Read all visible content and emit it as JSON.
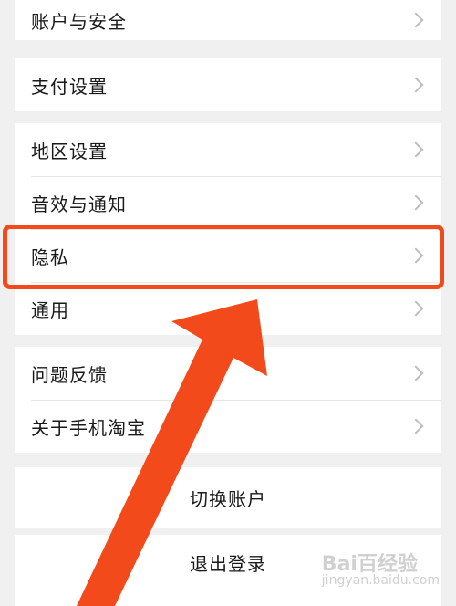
{
  "groups": [
    {
      "items": [
        {
          "label": "账户与安全"
        }
      ]
    },
    {
      "items": [
        {
          "label": "支付设置"
        }
      ]
    },
    {
      "items": [
        {
          "label": "地区设置"
        },
        {
          "label": "音效与通知"
        },
        {
          "label": "隐私"
        },
        {
          "label": "通用"
        }
      ]
    },
    {
      "items": [
        {
          "label": "问题反馈"
        },
        {
          "label": "关于手机淘宝"
        }
      ]
    }
  ],
  "actions": {
    "switch_account": "切换账户",
    "logout": "退出登录"
  },
  "watermark": {
    "text": "Bai百经验",
    "sub": "jingyan.baidu.com"
  },
  "colors": {
    "highlight": "#f24a1a",
    "arrow": "#f24a1a",
    "background": "#f0f0f0"
  }
}
